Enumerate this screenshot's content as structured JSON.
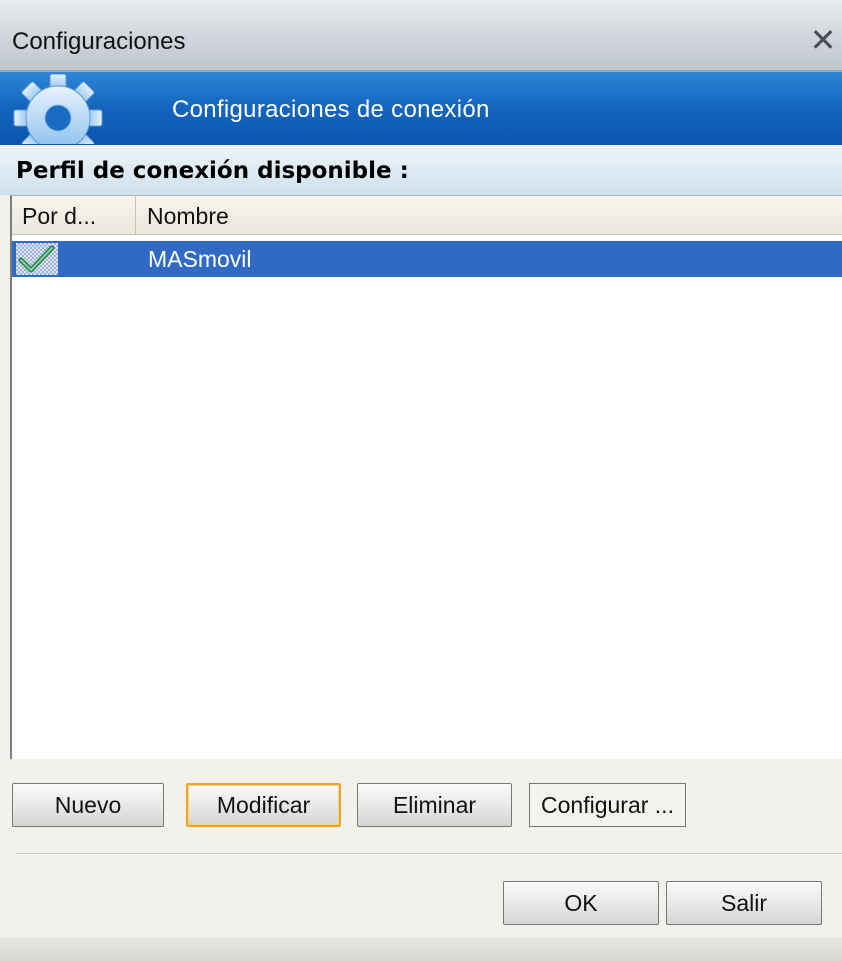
{
  "window": {
    "title": "Configuraciones",
    "close_symbol": "✕"
  },
  "banner": {
    "title": "Configuraciones de conexión",
    "icon": "gear-icon"
  },
  "profiles": {
    "label": "Perfil de conexión disponible :",
    "columns": [
      "Por d...",
      "Nombre"
    ],
    "rows": [
      {
        "is_default": true,
        "name": "MASmovil",
        "selected": true
      }
    ]
  },
  "actions": {
    "nuevo": "Nuevo",
    "modificar": "Modificar",
    "eliminar": "Eliminar",
    "configurar": "Configurar ..."
  },
  "footer": {
    "ok": "OK",
    "salir": "Salir"
  },
  "colors": {
    "banner": "#1466bf",
    "selection": "#316ac5",
    "focus_border": "#f0a22a"
  }
}
